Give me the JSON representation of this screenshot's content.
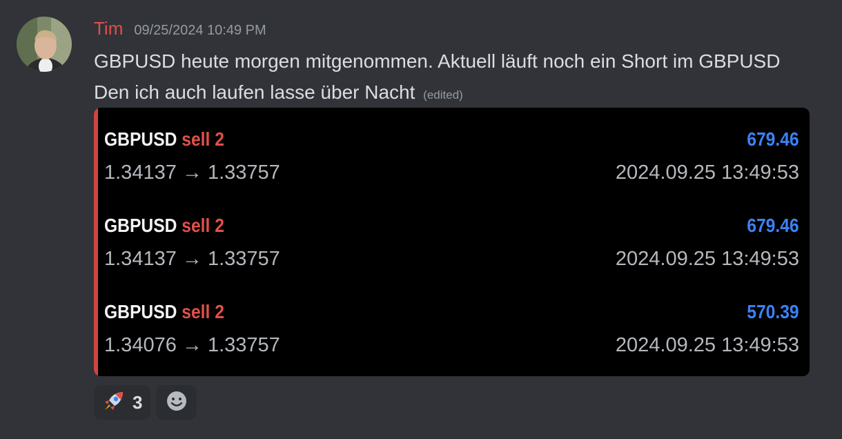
{
  "message": {
    "author": "Tim",
    "timestamp": "09/25/2024 10:49 PM",
    "text": "GBPUSD heute morgen mitgenommen. Aktuell läuft noch ein Short im GBPUSD Den ich auch laufen lasse über Nacht",
    "edited_label": "(edited)"
  },
  "embed": {
    "accent_color": "#d1453f",
    "trades": [
      {
        "symbol": "GBPUSD",
        "side": "sell 2",
        "profit": "679.46",
        "prices": "1.34137 → 1.33757",
        "time": "2024.09.25 13:49:53"
      },
      {
        "symbol": "GBPUSD",
        "side": "sell 2",
        "profit": "679.46",
        "prices": "1.34137 → 1.33757",
        "time": "2024.09.25 13:49:53"
      },
      {
        "symbol": "GBPUSD",
        "side": "sell 2",
        "profit": "570.39",
        "prices": "1.34076 → 1.33757",
        "time": "2024.09.25 13:49:53"
      }
    ]
  },
  "reactions": [
    {
      "icon": "rocket-icon",
      "count": "3"
    }
  ],
  "add_reaction_icon": "smiley-icon",
  "colors": {
    "background": "#313338",
    "username": "#e0504a",
    "profit": "#3b82f6",
    "side": "#e0504a"
  }
}
